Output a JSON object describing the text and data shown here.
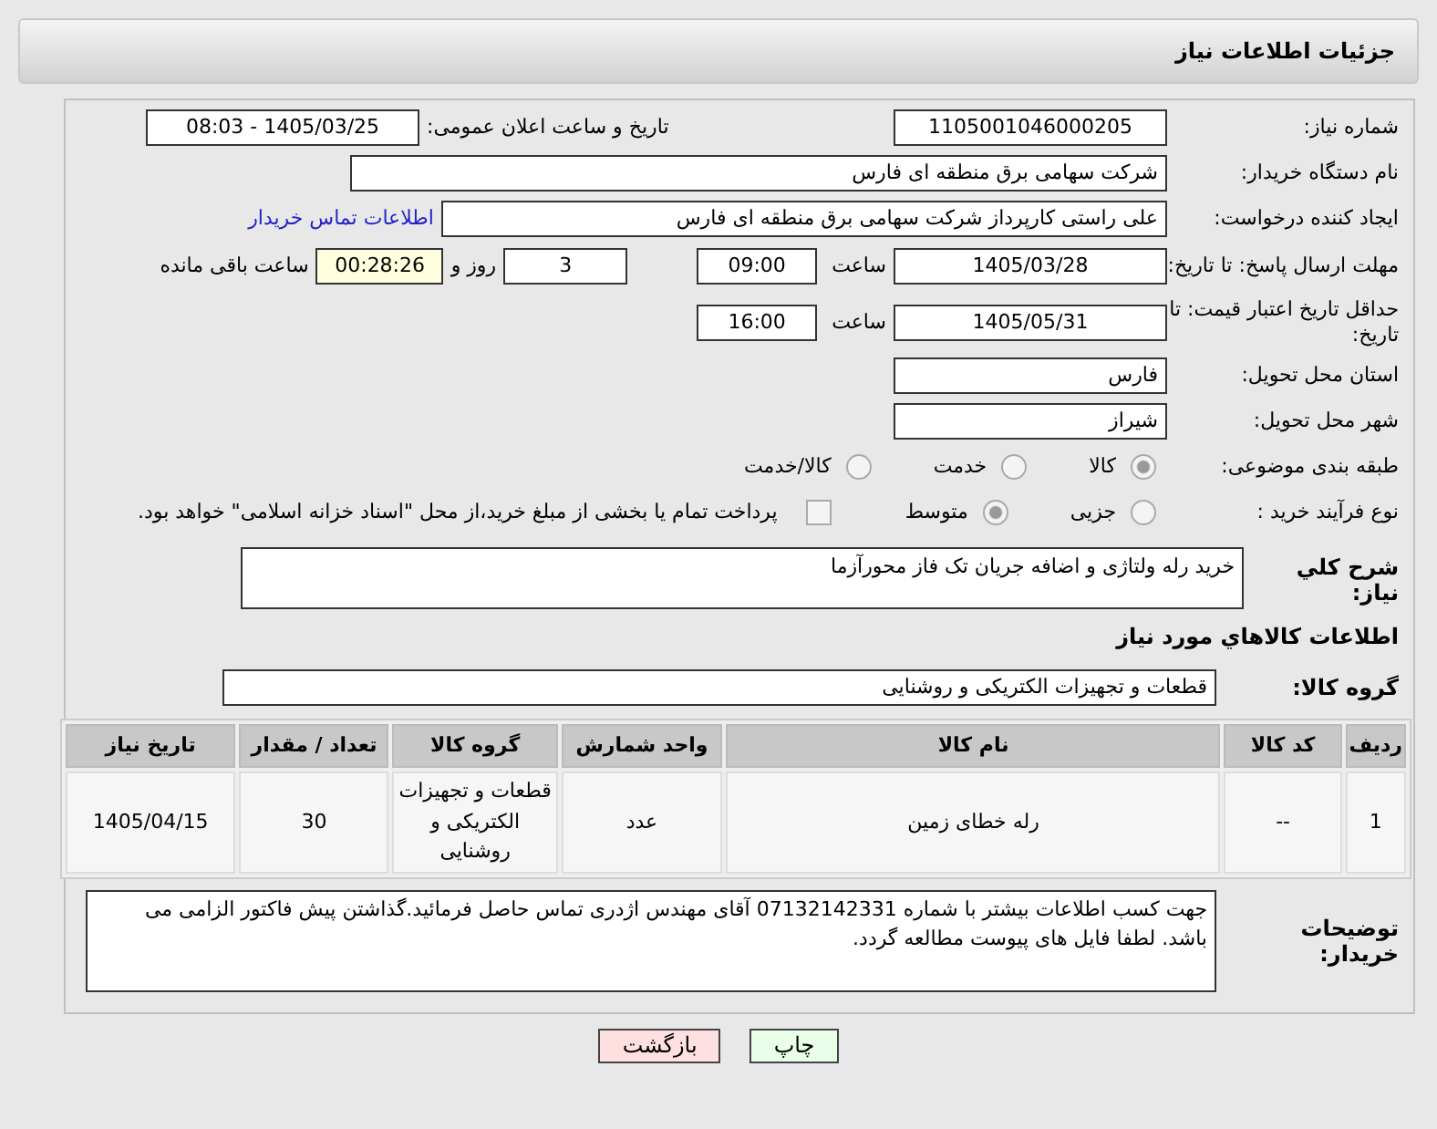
{
  "header": {
    "title": "جزئیات اطلاعات نیاز"
  },
  "need_number": {
    "label": "شماره نیاز:",
    "value": "1105001046000205"
  },
  "announce": {
    "label": "تاریخ و ساعت اعلان عمومی:",
    "value": "1405/03/25 - 08:03"
  },
  "buyer_org": {
    "label": "نام دستگاه خریدار:",
    "value": "شرکت سهامی برق منطقه ای فارس"
  },
  "requester": {
    "label": "ایجاد کننده درخواست:",
    "value": "علی راستی کارپرداز شرکت سهامی برق منطقه ای فارس",
    "link": "اطلاعات تماس خریدار"
  },
  "deadline": {
    "label": "مهلت ارسال پاسخ: تا تاریخ:",
    "date": "1405/03/28",
    "time_label": "ساعت",
    "time": "09:00",
    "days": "3",
    "days_label": "روز و",
    "remaining": "00:28:26",
    "remaining_label": "ساعت باقی مانده"
  },
  "validity": {
    "label": "حداقل تاریخ اعتبار قیمت: تا تاریخ:",
    "date": "1405/05/31",
    "time_label": "ساعت",
    "time": "16:00"
  },
  "province": {
    "label": "استان محل تحویل:",
    "value": "فارس"
  },
  "city": {
    "label": "شهر محل تحویل:",
    "value": "شیراز"
  },
  "category": {
    "label": "طبقه بندی موضوعی:",
    "options": [
      {
        "label": "کالا",
        "selected": true
      },
      {
        "label": "خدمت",
        "selected": false
      },
      {
        "label": "کالا/خدمت",
        "selected": false
      }
    ]
  },
  "process": {
    "label": "نوع فرآیند خرید :",
    "options": [
      {
        "label": "جزیی",
        "selected": false
      },
      {
        "label": "متوسط",
        "selected": true
      }
    ],
    "payment": {
      "checked": false,
      "text": "پرداخت تمام یا بخشی از مبلغ خرید،از محل \"اسناد خزانه اسلامی\" خواهد بود."
    }
  },
  "description": {
    "label": "شرح کلي نياز:",
    "value": "خرید رله ولتاژی و اضافه جریان تک فاز محورآزما"
  },
  "goods_heading": "اطلاعات کالاهاي مورد نياز",
  "goods_group": {
    "label": "گروه کالا:",
    "value": "قطعات و تجهیزات الکتریکی و روشنایی"
  },
  "table": {
    "columns": [
      "ردیف",
      "کد کالا",
      "نام کالا",
      "واحد شمارش",
      "گروه کالا",
      "تعداد / مقدار",
      "تاریخ نیاز"
    ],
    "rows": [
      [
        "1",
        "--",
        "رله خطای زمین",
        "عدد",
        "قطعات و تجهیزات الکتریکی و روشنایی",
        "30",
        "1405/04/15"
      ]
    ]
  },
  "buyer_notes": {
    "label": "توضیحات خریدار:",
    "value": "جهت کسب اطلاعات بیشتر با شماره 07132142331 آقای مهندس اژدری تماس حاصل فرمائید.گذاشتن پیش فاکتور الزامی می باشد. لطفا فایل های پیوست مطالعه گردد."
  },
  "buttons": [
    {
      "label": "چاپ",
      "kind": "print"
    },
    {
      "label": "بازگشت",
      "kind": "back"
    }
  ]
}
